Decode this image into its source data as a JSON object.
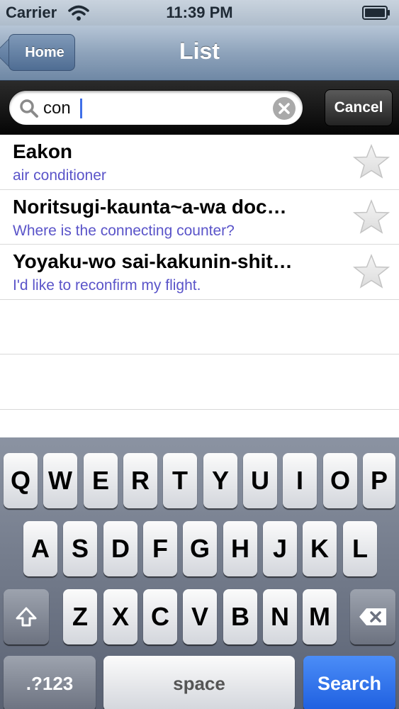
{
  "status_bar": {
    "carrier": "Carrier",
    "time": "11:39 PM"
  },
  "nav": {
    "back_label": "Home",
    "title": "List"
  },
  "search": {
    "value": "con",
    "cancel_label": "Cancel"
  },
  "results": [
    {
      "title": "Eakon",
      "subtitle": "air conditioner"
    },
    {
      "title": "Noritsugi-kaunta~a-wa doc…",
      "subtitle": "Where is the connecting counter?"
    },
    {
      "title": "Yoyaku-wo sai-kakunin-shit…",
      "subtitle": "I'd like to reconfirm my flight."
    }
  ],
  "keyboard": {
    "row1": [
      "Q",
      "W",
      "E",
      "R",
      "T",
      "Y",
      "U",
      "I",
      "O",
      "P"
    ],
    "row2": [
      "A",
      "S",
      "D",
      "F",
      "G",
      "H",
      "J",
      "K",
      "L"
    ],
    "row3": [
      "Z",
      "X",
      "C",
      "V",
      "B",
      "N",
      "M"
    ],
    "mode_label": ".?123",
    "space_label": "space",
    "search_label": "Search"
  },
  "colors": {
    "subtitle": "#5a54c9",
    "search_key": "#1e5fe0"
  }
}
